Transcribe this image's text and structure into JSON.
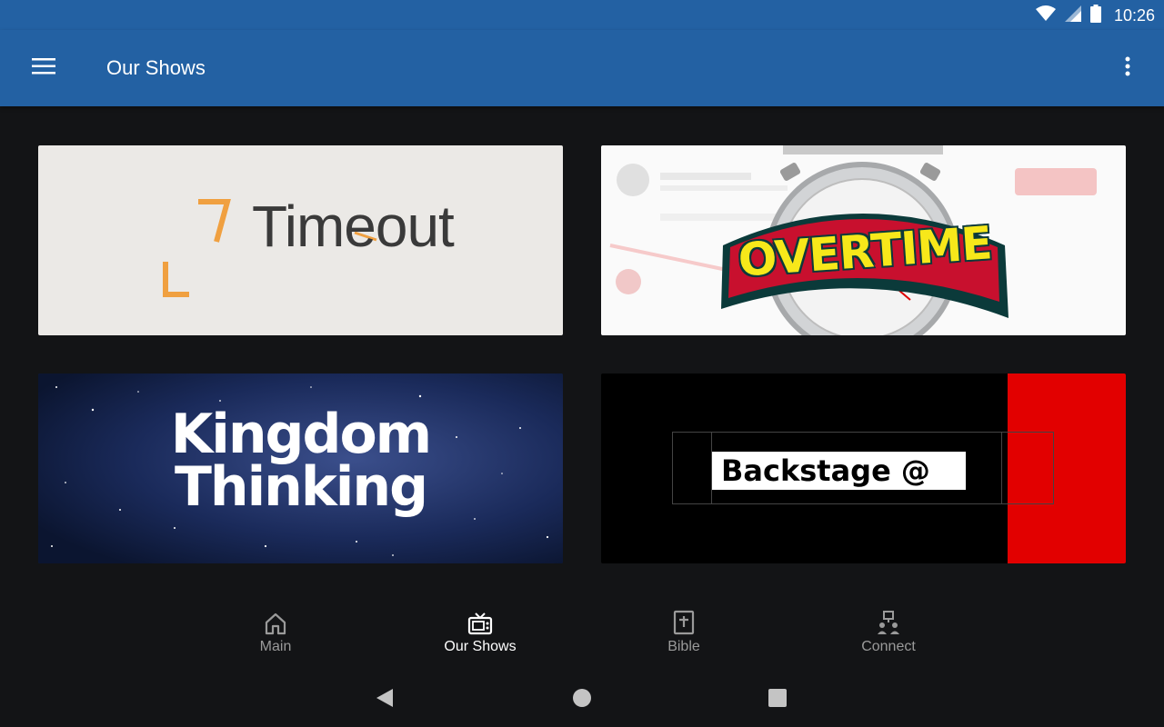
{
  "status_bar": {
    "time": "10:26",
    "icons": [
      "wifi-icon",
      "signal-icon",
      "battery-icon"
    ]
  },
  "app_bar": {
    "title": "Our Shows",
    "menu_icon": "hamburger-menu-icon",
    "more_icon": "more-vertical-icon"
  },
  "shows": [
    {
      "title": "Timeout"
    },
    {
      "title": "OVERTIME"
    },
    {
      "title_line1": "Kingdom",
      "title_line2": "Thinking"
    },
    {
      "title": "Backstage @"
    }
  ],
  "bottom_nav": {
    "items": [
      {
        "label": "Main",
        "icon": "home-icon",
        "active": false
      },
      {
        "label": "Our Shows",
        "icon": "tv-icon",
        "active": true
      },
      {
        "label": "Bible",
        "icon": "bible-icon",
        "active": false
      },
      {
        "label": "Connect",
        "icon": "connect-icon",
        "active": false
      }
    ]
  },
  "system_nav": {
    "icons": [
      "back-icon",
      "home-circle-icon",
      "recents-icon"
    ]
  },
  "colors": {
    "primary": "#2361a3",
    "background": "#131416",
    "timeout_accent": "#f0a040",
    "backstage_red": "#e20000"
  }
}
